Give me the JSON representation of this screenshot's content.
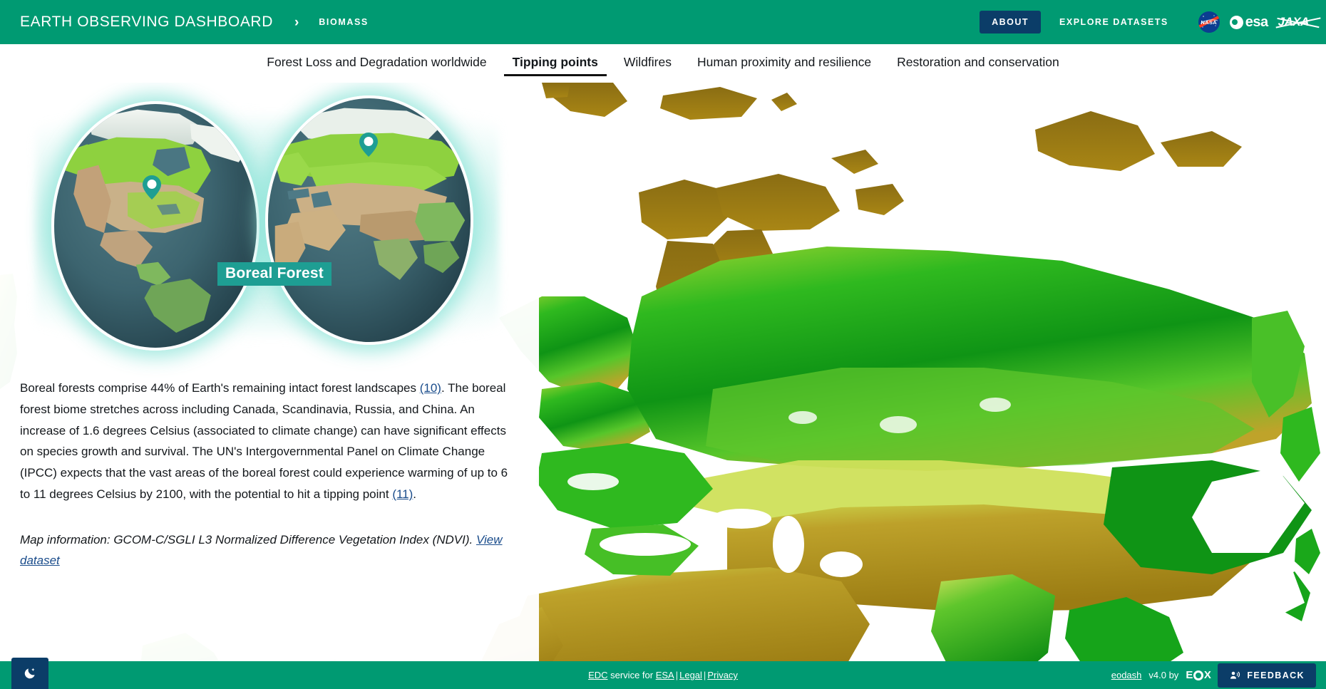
{
  "header": {
    "brand_title": "EARTH OBSERVING DASHBOARD",
    "breadcrumb_separator": "›",
    "breadcrumb_current": "BIOMASS",
    "about_label": "ABOUT",
    "explore_label": "EXPLORE DATASETS",
    "logos": [
      {
        "name": "nasa-logo",
        "text": "NASA"
      },
      {
        "name": "esa-logo",
        "text": "esa"
      },
      {
        "name": "jaxa-logo",
        "text": "JAXA"
      }
    ],
    "colors": {
      "brand_green": "#009A72",
      "accent_navy": "#0B3D68"
    }
  },
  "nav": {
    "tabs": [
      {
        "label": "Forest Loss and Degradation worldwide",
        "active": false
      },
      {
        "label": "Tipping points",
        "active": true
      },
      {
        "label": "Wildfires",
        "active": false
      },
      {
        "label": "Human proximity and resilience",
        "active": false
      },
      {
        "label": "Restoration and conservation",
        "active": false
      }
    ]
  },
  "illustration": {
    "caption": "Boreal Forest",
    "globe_left_region": "North America",
    "globe_right_region": "Eurasia",
    "marker_icon": "map-pin-icon",
    "caption_color": "#1E9E93"
  },
  "content": {
    "paragraph_parts": {
      "p1_a": "Boreal forests comprise 44% of Earth's remaining intact forest landscapes ",
      "ref_10": "(10)",
      "p1_b": ". The boreal forest biome stretches across including Canada, Scandinavia, Russia, and China. An increase of 1.6 degrees Celsius (associated to climate change) can have significant effects on species growth and survival. The UN's Intergovernmental Panel on Climate Change (IPCC) expects that the vast areas of the boreal forest could experience warming of up to 6 to 11 degrees Celsius by 2100, with the potential to hit a tipping point ",
      "ref_11": "(11)",
      "p1_c": "."
    },
    "map_info": {
      "label": "Map information: GCOM-C/SGLI L3 Normalized Difference Vegetation Index (NDVI). ",
      "link_label": "View dataset"
    }
  },
  "map": {
    "layer_name": "GCOM-C/SGLI L3 Normalized Difference Vegetation Index (NDVI)",
    "background_color": "#ffffff",
    "palette": [
      "#8a6d13",
      "#b08a16",
      "#d2c34a",
      "#cfe05a",
      "#9ad93a",
      "#3fc424",
      "#16a41a",
      "#0c8412"
    ]
  },
  "footer": {
    "theme_toggle_icon": "moon-star-icon",
    "edc_link": "EDC",
    "service_for": " service for ",
    "esa_link": "ESA",
    "legal_link": "Legal",
    "privacy_link": "Privacy",
    "separator": "|",
    "eodash_link": "eodash",
    "version": "v4.0 by",
    "eox_logo": "EOX",
    "feedback_label": "FEEDBACK",
    "feedback_icon": "megaphone-icon"
  }
}
